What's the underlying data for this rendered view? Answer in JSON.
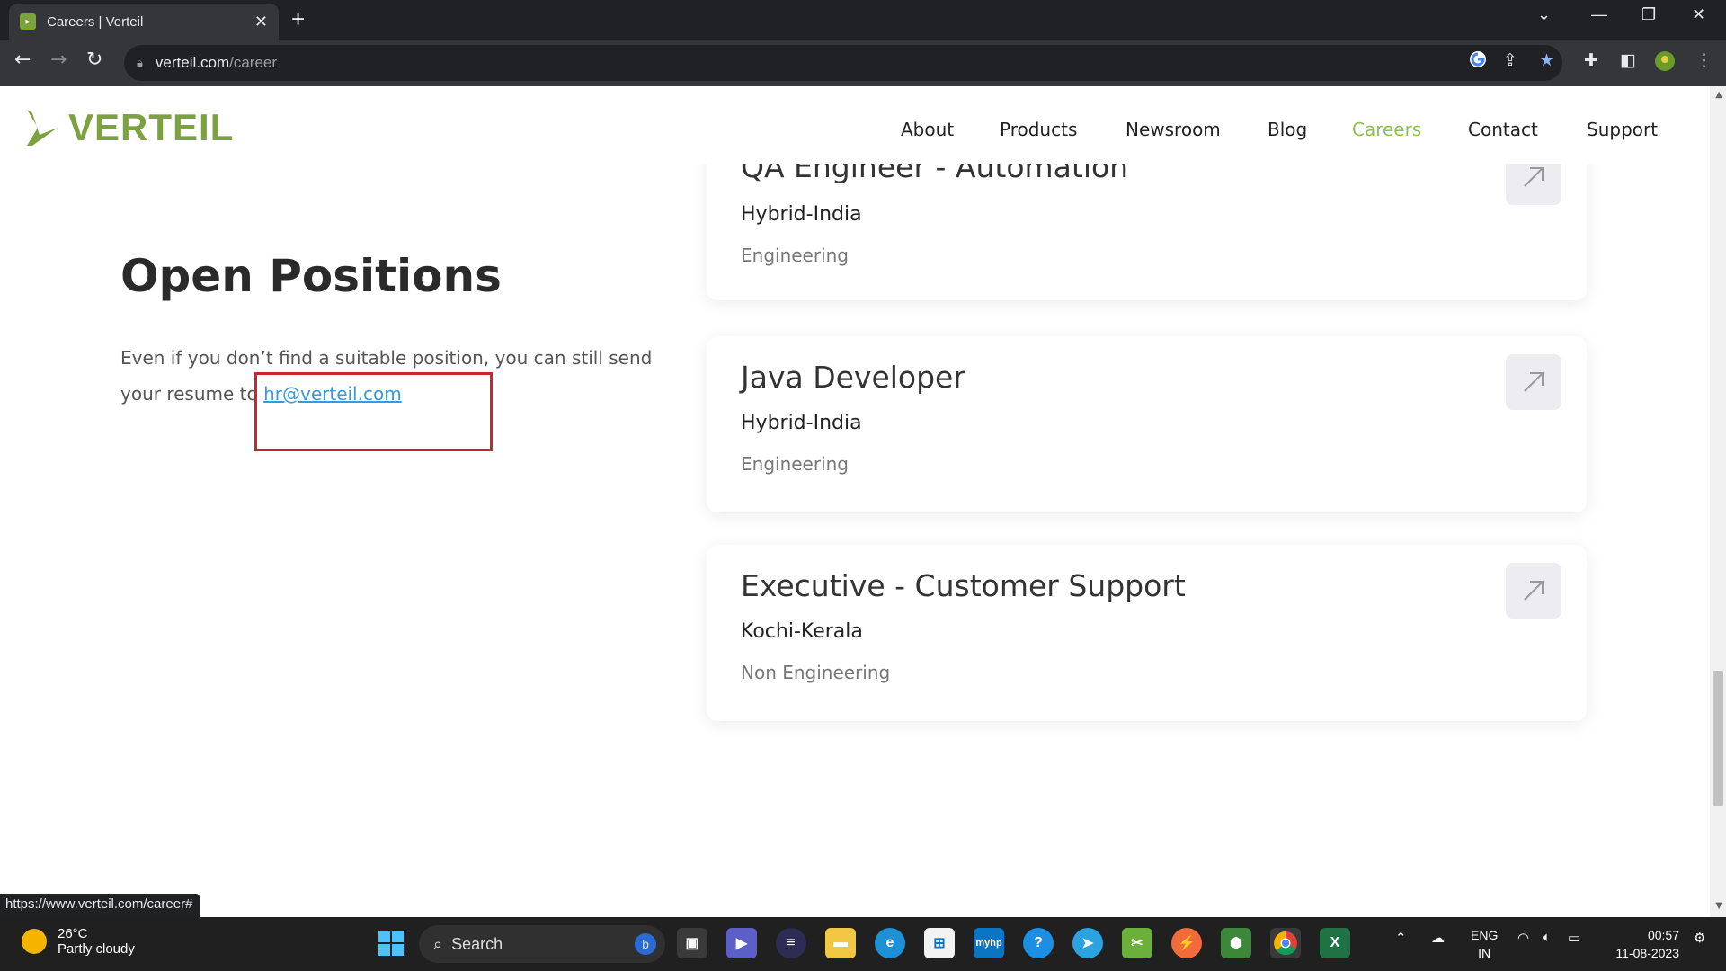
{
  "browser": {
    "tab_title": "Careers | Verteil",
    "url_host": "verteil.com",
    "url_path": "/career",
    "status_url": "https://www.verteil.com/career#"
  },
  "site": {
    "logo_text": "VERTEIL",
    "nav": [
      "About",
      "Products",
      "Newsroom",
      "Blog",
      "Careers",
      "Contact",
      "Support"
    ],
    "active_nav": "Careers",
    "brand_color": "#7ba23f"
  },
  "main": {
    "heading": "Open Positions",
    "description_before": "Even if you don’t find a suitable position, you can still send your resume to ",
    "email": "hr@verteil.com"
  },
  "jobs": [
    {
      "title": "QA Engineer - Automation",
      "location": "Hybrid-India",
      "department": "Engineering"
    },
    {
      "title": "Java Developer",
      "location": "Hybrid-India",
      "department": "Engineering"
    },
    {
      "title": "Executive - Customer Support",
      "location": "Kochi-Kerala",
      "department": "Non Engineering"
    }
  ],
  "taskbar": {
    "weather_temp": "26°C",
    "weather_condition": "Partly cloudy",
    "search_label": "Search",
    "lang_line1": "ENG",
    "lang_line2": "IN",
    "time": "00:57",
    "date": "11-08-2023"
  }
}
